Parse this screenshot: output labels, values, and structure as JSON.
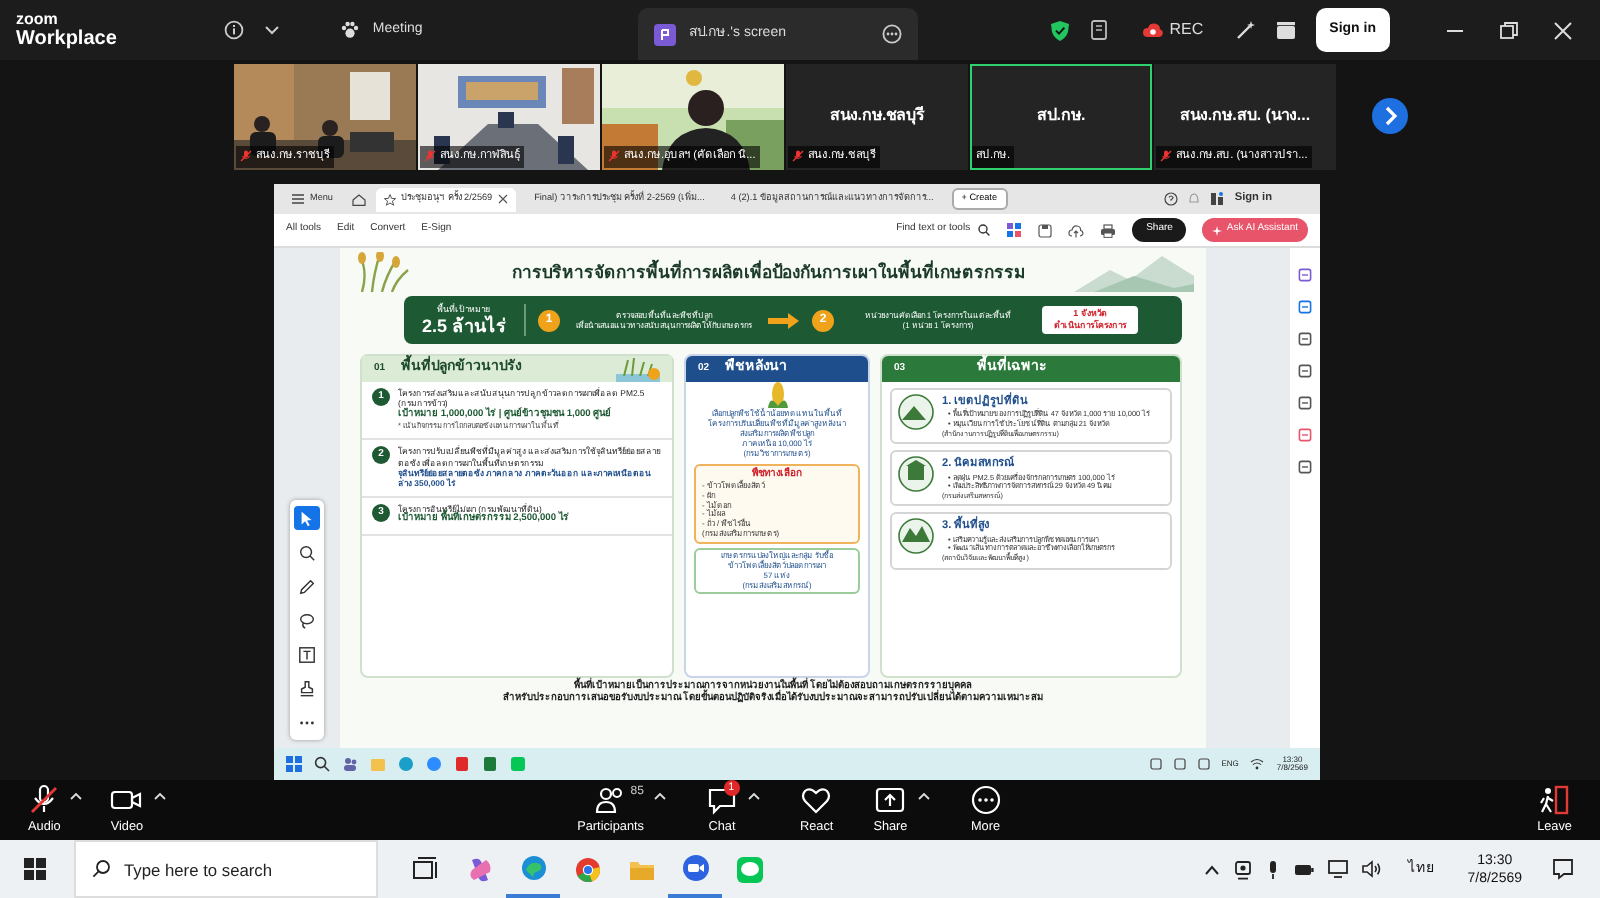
{
  "titlebar": {
    "brand_line1": "zoom",
    "brand_line2": "Workplace",
    "tabs": [
      {
        "kind": "meeting",
        "label": "Meeting",
        "selected": false
      },
      {
        "kind": "screen",
        "label": "สป.กษ.'s screen",
        "selected": true
      }
    ],
    "rec_label": "REC",
    "sign_in": "Sign in"
  },
  "participants": [
    {
      "kind": "video",
      "name": "สนง.กษ.ราชบุรี",
      "muted": true,
      "active_speaker": false
    },
    {
      "kind": "video",
      "name": "สนง.กษ.กาฬสินธุ์",
      "muted": true,
      "active_speaker": false
    },
    {
      "kind": "video",
      "name": "สนง.กษ.อุบลฯ (คัดเลือก นิ...",
      "muted": true,
      "active_speaker": false
    },
    {
      "kind": "name",
      "display": "สนง.กษ.ชลบุรี",
      "name": "สนง.กษ.ชลบุรี",
      "muted": true,
      "active_speaker": false
    },
    {
      "kind": "name",
      "display": "สป.กษ.",
      "name": "สป.กษ.",
      "muted": false,
      "active_speaker": true
    },
    {
      "kind": "name",
      "display": "สนง.กษ.สบ. (นาง...",
      "name": "สนง.กษ.สบ. (นางสาวปรา...",
      "muted": true,
      "active_speaker": false
    }
  ],
  "shared_screen": {
    "acrobat": {
      "menu": "Menu",
      "tabs": [
        {
          "label": "ประชุมอนุฯ ครั้ง 2/2569",
          "selected": true
        },
        {
          "label": "Final) วาระการประชุม ครั้งที่ 2-2569 (เพิ่ม...",
          "selected": false
        },
        {
          "label": "4 (2).1 ข้อมูลสถานการณ์และแนวทางการจัดการ...",
          "selected": false
        }
      ],
      "create": "+ Create",
      "sign_in": "Sign in",
      "tools": [
        "All tools",
        "Edit",
        "Convert",
        "E-Sign"
      ],
      "find": "Find text or tools",
      "share": "Share",
      "ai": "Ask AI Assistant",
      "canvas_tools": [
        {
          "kind": "select",
          "selected": true
        },
        {
          "kind": "comment",
          "selected": false
        },
        {
          "kind": "pen",
          "selected": false
        },
        {
          "kind": "lasso",
          "selected": false
        },
        {
          "kind": "textbox",
          "selected": false
        },
        {
          "kind": "stamp",
          "selected": false
        },
        {
          "kind": "more",
          "selected": false
        }
      ]
    },
    "document": {
      "title": "การบริหารจัดการพื้นที่การผลิตเพื่อป้องกันการเผาในพื้นที่เกษตรกรรม",
      "target": {
        "label": "พื้นที่เป้าหมาย",
        "value": "2.5 ล้านไร่"
      },
      "steps": [
        {
          "number": "1",
          "lines": [
            "ตรวจสอบพื้นที่และพืชที่ปลูก",
            "เพื่อนำเสนอแนวทางสนับสนุนการผลิตให้กับเกษตรกร"
          ]
        },
        {
          "number": "2",
          "lines": [
            "หน่วยงานคัดเลือก 1 โครงการในแต่ละพื้นที่",
            "(1 หน่วย 1 โครงการ)"
          ]
        }
      ],
      "result": [
        "1 จังหวัด",
        "ดำเนินการโครงการ"
      ],
      "sections": [
        {
          "kind": "projects",
          "number": "01",
          "title": "พื้นที่ปลูกข้าวนาปรัง",
          "items": [
            {
              "number": "1",
              "lines": [
                {
                  "kind": "body",
                  "text": "โครงการส่งเสริมและสนับสนุนการปลูกข้าวลดการเผาเพื่อลด PM2.5 (กรมการข้าว)"
                },
                {
                  "kind": "target",
                  "text": "เป้าหมาย  1,000,000 ไร่  |  ศูนย์ข้าวชุมชน 1,000 ศูนย์"
                },
                {
                  "kind": "note",
                  "text": "* เน้นกิจกรรมการไถกลบตอซังแทนการเผาในพื้นที่"
                }
              ]
            },
            {
              "number": "2",
              "lines": [
                {
                  "kind": "body",
                  "text": "โครงการปรับเปลี่ยนพืชที่มีมูลค่าสูง และส่งเสริมการใช้จุลินทรีย์ย่อยสลายตอซัง เพื่อลดการเผาในพื้นที่เกษตรกรรม"
                },
                {
                  "kind": "link",
                  "text": "จุลินทรีย์ย่อยสลายตอซัง ภาคกลาง ภาคตะวันออก และภาคเหนือตอนล่าง 350,000 ไร่"
                }
              ]
            },
            {
              "number": "3",
              "lines": [
                {
                  "kind": "body",
                  "text": "โครงการอินทรีย์ไม่เผา (กรมพัฒนาที่ดิน)"
                },
                {
                  "kind": "target",
                  "text": "เป้าหมาย  พื้นที่เกษตรกรรม 2,500,000 ไร่"
                }
              ]
            }
          ]
        },
        {
          "kind": "crops",
          "number": "02",
          "title": "พืชหลังนา",
          "intro": [
            "เลือกปลูกพืชใช้น้ำน้อยทดแทนในพื้นที่",
            "โครงการปรับเปลี่ยนพืชที่มีมูลค่าสูงหลังนา",
            "ส่งเสริมการผลิตพืชปลูก",
            "ภาคเหนือ 10,000 ไร่",
            "(กรมวิชาการเกษตร)"
          ],
          "options_title": "พืชทางเลือก",
          "options": [
            "- ข้าวโพดเลี้ยงสัตว์",
            "- ผัก",
            "- ไม้ดอก",
            "- ไม้ผล",
            "- ถั่ว / พืชไร่อื่น",
            "(กรมส่งเสริมการเกษตร)"
          ],
          "note": [
            "เกษตรกรแปลงใหญ่และกลุ่ม รับซื้อ",
            "ข้าวโพดเลี้ยงสัตว์ปลอดการเผา",
            "57 แห่ง",
            "(กรมส่งเสริมสหกรณ์)"
          ]
        },
        {
          "kind": "areas",
          "number": "03",
          "title": "พื้นที่เฉพาะ",
          "items": [
            {
              "title": "1. เขตปฏิรูปที่ดิน",
              "bullets": [
                "• พื้นที่เป้าหมายของการปฏิรูปที่ดิน 47 จังหวัด 1,000 ราย 10,000 ไร่",
                "• หมุนเวียนการใช้ประโยชน์ที่ดิน ตามกลุ่ม 21 จังหวัด"
              ],
              "source": "(สำนักงานการปฏิรูปที่ดินเพื่อเกษตรกรรม)"
            },
            {
              "title": "2. นิคมสหกรณ์",
              "bullets": [
                "• ลดฝุ่น PM2.5 ด้วยเครื่องจักรกลการเกษตร 100,000 ไร่",
                "• เพิ่มประสิทธิภาพการจัดการสหกรณ์ 29 จังหวัด 49 นิคม"
              ],
              "source": "(กรมส่งเสริมสหกรณ์)"
            },
            {
              "title": "3. พื้นที่สูง",
              "bullets": [
                "• เสริมความรู้และส่งเสริมการปลูกพืชทดแทนการเผา",
                "• พัฒนาเส้นทางการตลาดและอาชีพทางเลือกให้เกษตรกร"
              ],
              "source": "(สถาบันวิจัยและพัฒนาพื้นที่สูง)"
            }
          ]
        }
      ],
      "footer": [
        "พื้นที่เป้าหมายเป็นการประมาณการจากหน่วยงานในพื้นที่ โดยไม่ต้องสอบถามเกษตรกรรายบุคคล",
        "สำหรับประกอบการเสนอขอรับงบประมาณ โดยขั้นตอนปฏิบัติจริงเมื่อได้รับงบประมาณจะสามารถปรับเปลี่ยนได้ตามความเหมาะสม"
      ]
    },
    "taskbar": {
      "lang": "ENG",
      "time": "13:30",
      "date": "7/8/2569"
    }
  },
  "controls": [
    {
      "kind": "audio",
      "label": "Audio",
      "muted": true,
      "caret": true
    },
    {
      "kind": "video",
      "label": "Video",
      "caret": true
    },
    {
      "kind": "participants",
      "label": "Participants",
      "count": "85",
      "caret": true
    },
    {
      "kind": "chat",
      "label": "Chat",
      "badge": "1",
      "caret": true
    },
    {
      "kind": "react",
      "label": "React"
    },
    {
      "kind": "share",
      "label": "Share",
      "caret": true
    },
    {
      "kind": "more",
      "label": "More"
    },
    {
      "kind": "leave",
      "label": "Leave"
    }
  ],
  "taskbar": {
    "search_placeholder": "Type here to search",
    "apps": [
      {
        "kind": "taskview",
        "running": false
      },
      {
        "kind": "copilot",
        "running": false
      },
      {
        "kind": "edge",
        "running": true
      },
      {
        "kind": "chrome",
        "running": false
      },
      {
        "kind": "explorer",
        "running": false
      },
      {
        "kind": "zoom",
        "running": true
      },
      {
        "kind": "line",
        "running": false
      }
    ],
    "language": "ไทย",
    "time": "13:30",
    "date": "7/8/2569"
  }
}
